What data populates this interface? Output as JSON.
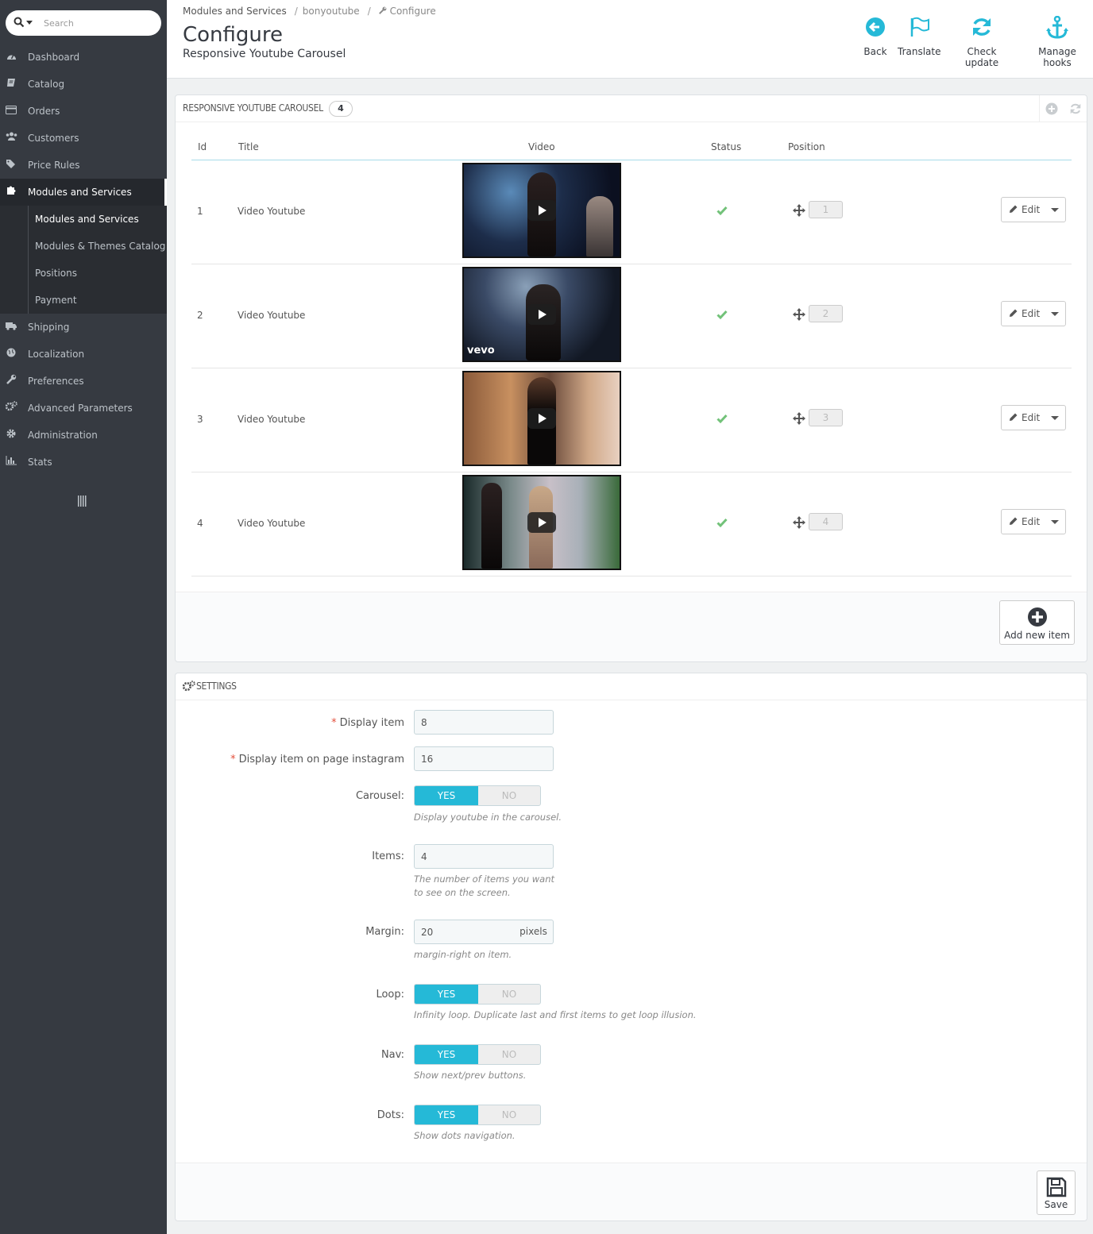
{
  "search": {
    "placeholder": "Search"
  },
  "sidebar": {
    "items": [
      {
        "label": "Dashboard",
        "icon": "dashboard-icon"
      },
      {
        "label": "Catalog",
        "icon": "book-icon"
      },
      {
        "label": "Orders",
        "icon": "credit-card-icon"
      },
      {
        "label": "Customers",
        "icon": "users-icon"
      },
      {
        "label": "Price Rules",
        "icon": "tags-icon"
      },
      {
        "label": "Modules and Services",
        "icon": "puzzle-icon",
        "active": true
      },
      {
        "label": "Shipping",
        "icon": "truck-icon"
      },
      {
        "label": "Localization",
        "icon": "globe-icon"
      },
      {
        "label": "Preferences",
        "icon": "wrench-icon"
      },
      {
        "label": "Advanced Parameters",
        "icon": "cogs-icon"
      },
      {
        "label": "Administration",
        "icon": "gear-icon"
      },
      {
        "label": "Stats",
        "icon": "bar-chart-icon"
      }
    ],
    "subitems": [
      {
        "label": "Modules and Services",
        "active": true
      },
      {
        "label": "Modules & Themes Catalog"
      },
      {
        "label": "Positions"
      },
      {
        "label": "Payment"
      }
    ]
  },
  "header": {
    "breadcrumb": [
      "Modules and Services",
      "bonyoutube",
      "Configure"
    ],
    "title": "Configure",
    "subtitle": "Responsive Youtube Carousel",
    "toolbar": [
      {
        "label": "Back",
        "icon": "arrow-circle-left-icon"
      },
      {
        "label": "Translate",
        "icon": "flag-icon"
      },
      {
        "label": "Check update",
        "icon": "refresh-icon"
      },
      {
        "label": "Manage hooks",
        "icon": "anchor-icon"
      }
    ]
  },
  "carousel_panel": {
    "title": "Responsive Youtube Carousel",
    "count": "4",
    "columns": [
      "Id",
      "Title",
      "Video",
      "Status",
      "Position"
    ],
    "rows": [
      {
        "id": "1",
        "title": "Video Youtube",
        "status": "enabled",
        "position": "1"
      },
      {
        "id": "2",
        "title": "Video Youtube",
        "status": "enabled",
        "position": "2"
      },
      {
        "id": "3",
        "title": "Video Youtube",
        "status": "enabled",
        "position": "3"
      },
      {
        "id": "4",
        "title": "Video Youtube",
        "status": "enabled",
        "position": "4"
      }
    ],
    "vevo_label": "vevo",
    "edit_label": "Edit",
    "add_label": "Add new item"
  },
  "settings": {
    "title": "Settings",
    "display_item": {
      "label": "Display item",
      "value": "8"
    },
    "display_item_instagram": {
      "label": "Display item on page instagram",
      "value": "16"
    },
    "carousel": {
      "label": "Carousel:",
      "value": "YES",
      "yes": "YES",
      "no": "NO",
      "help": "Display youtube in the carousel."
    },
    "items": {
      "label": "Items:",
      "value": "4",
      "help1": "The number of items you want",
      "help2": "to see on the screen."
    },
    "margin": {
      "label": "Margin:",
      "value": "20",
      "addon": "pixels",
      "help": "margin-right on item."
    },
    "loop": {
      "label": "Loop:",
      "value": "YES",
      "yes": "YES",
      "no": "NO",
      "help": "Infinity loop. Duplicate last and first items to get loop illusion."
    },
    "nav": {
      "label": "Nav:",
      "value": "YES",
      "yes": "YES",
      "no": "NO",
      "help": "Show next/prev buttons."
    },
    "dots": {
      "label": "Dots:",
      "value": "YES",
      "yes": "YES",
      "no": "NO",
      "help": "Show dots navigation."
    },
    "save_label": "Save"
  },
  "colors": {
    "accent": "#25b9d7",
    "sidebar": "#363a41",
    "success": "#72c279"
  }
}
